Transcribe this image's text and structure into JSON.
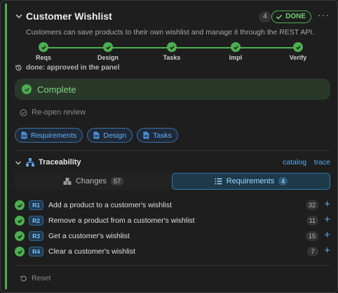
{
  "header": {
    "title": "Customer Wishlist",
    "count": "4",
    "status": "DONE",
    "more": "···"
  },
  "description": "Customers can save products to their own wishlist and manage it through the REST API.",
  "steps": [
    {
      "label": "Reqs"
    },
    {
      "label": "Design"
    },
    {
      "label": "Tasks"
    },
    {
      "label": "Impl"
    },
    {
      "label": "Verify"
    }
  ],
  "done_note": "done: approved in the panel",
  "complete_label": "Complete",
  "reopen_label": "Re-open review",
  "doc_pills": [
    {
      "label": "Requirements"
    },
    {
      "label": "Design"
    },
    {
      "label": "Tasks"
    }
  ],
  "traceability": {
    "title": "Traceability",
    "link_catalog": "catalog",
    "link_trace": "trace"
  },
  "tabs": [
    {
      "label": "Changes",
      "count": "57"
    },
    {
      "label": "Requirements",
      "count": "4"
    }
  ],
  "requirements": [
    {
      "id": "R1",
      "text": "Add a product to a customer's wishlist",
      "count": "32"
    },
    {
      "id": "R2",
      "text": "Remove a product from a customer's wishlist",
      "count": "11"
    },
    {
      "id": "R3",
      "text": "Get a customer's wishlist",
      "count": "15"
    },
    {
      "id": "R4",
      "text": "Clear a customer's wishlist",
      "count": "7"
    }
  ],
  "add_symbol": "+",
  "reset_label": "Reset",
  "colors": {
    "success": "#4caf50",
    "link": "#5aa9ef",
    "active_tab": "#1e3a4a"
  }
}
